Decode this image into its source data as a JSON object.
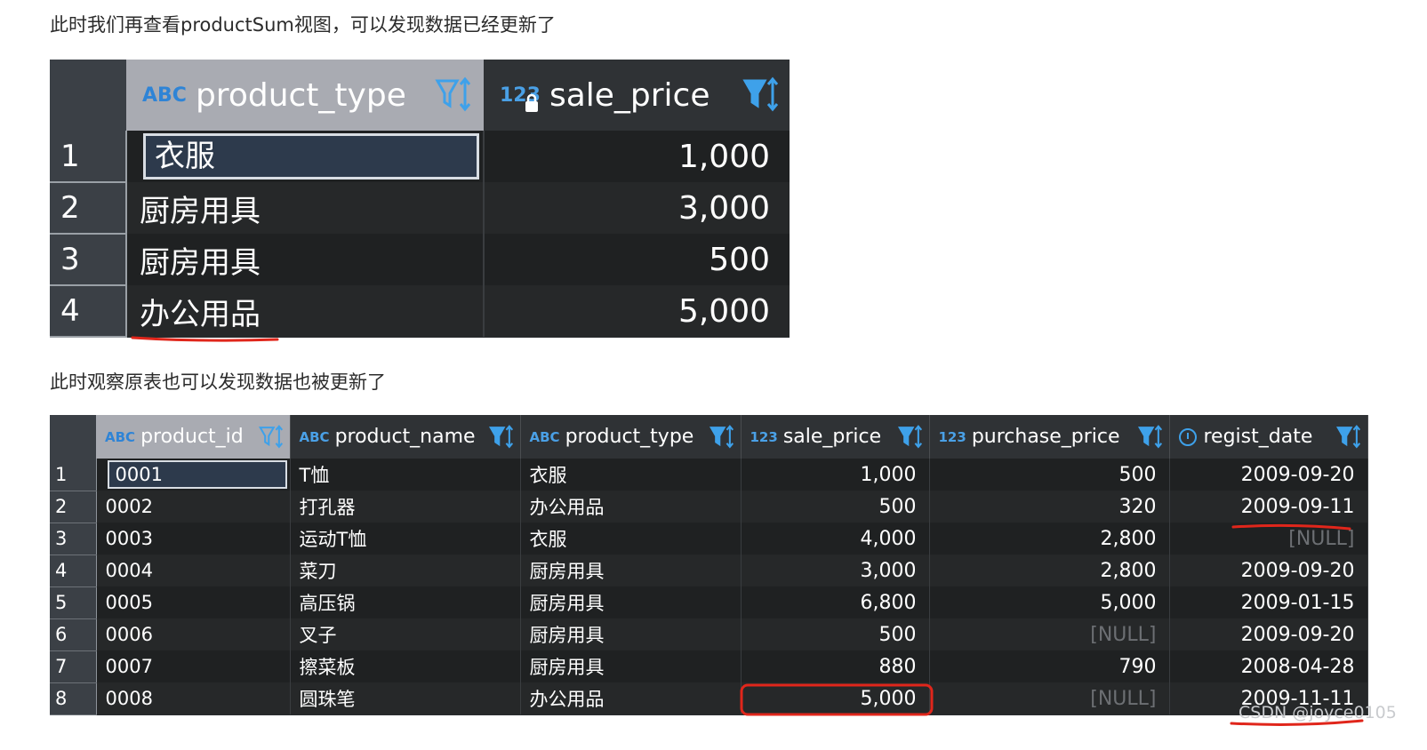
{
  "paragraph1": "此时我们再查看productSum视图，可以发现数据已经更新了",
  "paragraph2": "此时观察原表也可以发现数据也被更新了",
  "view_grid": {
    "columns": [
      {
        "type_tag": "ABC",
        "name": "product_type",
        "icon": "filter-sort-icon"
      },
      {
        "type_tag": "123",
        "name": "sale_price",
        "icon": "filter-sort-icon",
        "lock": true
      }
    ],
    "rows": [
      {
        "n": "1",
        "product_type": "衣服",
        "sale_price": "1,000"
      },
      {
        "n": "2",
        "product_type": "厨房用具",
        "sale_price": "3,000"
      },
      {
        "n": "3",
        "product_type": "厨房用具",
        "sale_price": "500"
      },
      {
        "n": "4",
        "product_type": "办公用品",
        "sale_price": "5,000"
      }
    ]
  },
  "table_grid": {
    "columns": [
      {
        "type_tag": "ABC",
        "name": "product_id"
      },
      {
        "type_tag": "ABC",
        "name": "product_name"
      },
      {
        "type_tag": "ABC",
        "name": "product_type"
      },
      {
        "type_tag": "123",
        "name": "sale_price"
      },
      {
        "type_tag": "123",
        "name": "purchase_price"
      },
      {
        "type_tag": "clock",
        "name": "regist_date"
      }
    ],
    "rows": [
      {
        "n": "1",
        "product_id": "0001",
        "product_name": "T恤",
        "product_type": "衣服",
        "sale_price": "1,000",
        "purchase_price": "500",
        "regist_date": "2009-09-20"
      },
      {
        "n": "2",
        "product_id": "0002",
        "product_name": "打孔器",
        "product_type": "办公用品",
        "sale_price": "500",
        "purchase_price": "320",
        "regist_date": "2009-09-11"
      },
      {
        "n": "3",
        "product_id": "0003",
        "product_name": "运动T恤",
        "product_type": "衣服",
        "sale_price": "4,000",
        "purchase_price": "2,800",
        "regist_date": "[NULL]"
      },
      {
        "n": "4",
        "product_id": "0004",
        "product_name": "菜刀",
        "product_type": "厨房用具",
        "sale_price": "3,000",
        "purchase_price": "2,800",
        "regist_date": "2009-09-20"
      },
      {
        "n": "5",
        "product_id": "0005",
        "product_name": "高压锅",
        "product_type": "厨房用具",
        "sale_price": "6,800",
        "purchase_price": "5,000",
        "regist_date": "2009-01-15"
      },
      {
        "n": "6",
        "product_id": "0006",
        "product_name": "叉子",
        "product_type": "厨房用具",
        "sale_price": "500",
        "purchase_price": "[NULL]",
        "regist_date": "2009-09-20"
      },
      {
        "n": "7",
        "product_id": "0007",
        "product_name": "擦菜板",
        "product_type": "厨房用具",
        "sale_price": "880",
        "purchase_price": "790",
        "regist_date": "2008-04-28"
      },
      {
        "n": "8",
        "product_id": "0008",
        "product_name": "圆珠笔",
        "product_type": "办公用品",
        "sale_price": "5,000",
        "purchase_price": "[NULL]",
        "regist_date": "2009-11-11"
      }
    ]
  },
  "watermark": "CSDN @joyce0105",
  "colors": {
    "grid_bg": "#1f2122",
    "header_selected": "#a9abb2",
    "type_icon": "#3ea1ea",
    "annotation_red": "#e0261b",
    "null_text": "#6c6f73"
  }
}
